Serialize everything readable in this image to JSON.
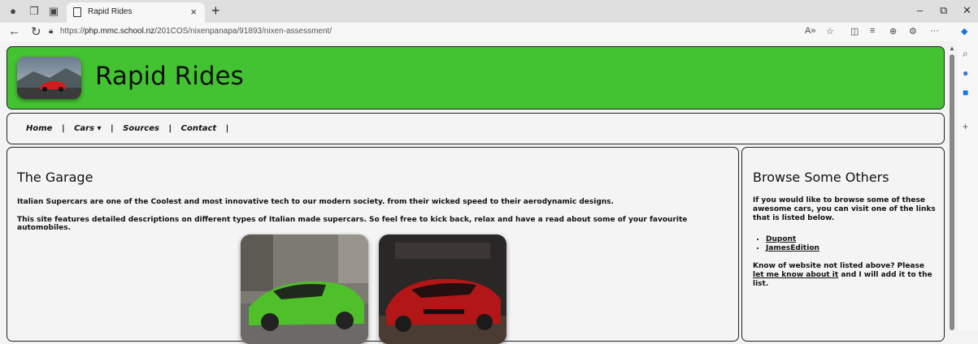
{
  "browser": {
    "tab_title": "Rapid Rides",
    "url_prefix": "https://",
    "url_host": "php.mmc.school.nz",
    "url_path": "/201COS/nixenpanapa/91893/nixen-assessment/"
  },
  "site": {
    "title": "Rapid Rides",
    "nav": [
      "Home",
      "|",
      "Cars ▾",
      "|",
      "Sources",
      "|",
      "Contact",
      "|"
    ]
  },
  "main": {
    "heading": "The Garage",
    "para1": "Italian Supercars are one of the Coolest and most innovative tech to our modern society. from their wicked speed to their aerodynamic designs.",
    "para2": "This site features detailed descriptions on different types of Italian made supercars. So feel free to kick back, relax and have a read about some of your favourite automobiles."
  },
  "sidebar": {
    "heading": "Browse Some Others",
    "intro": "If you would like to browse some of these awesome cars, you can visit one of the links that is listed below.",
    "links": [
      "Dupont",
      "JamesEdition"
    ],
    "outro_before": "Know of website not listed above? Please ",
    "outro_link": "let me know about it",
    "outro_after": " and I will add it to the list."
  },
  "colors": {
    "header_green": "#43c232"
  }
}
